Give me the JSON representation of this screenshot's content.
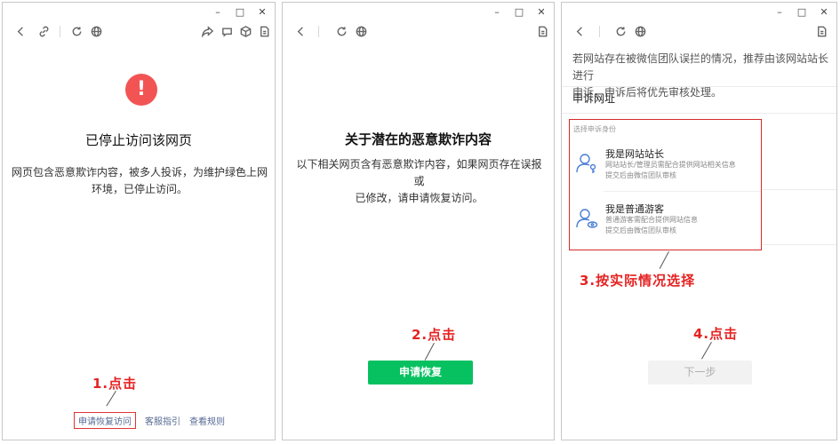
{
  "window_controls": {
    "minimize": "–",
    "maximize": "□",
    "close": "✕"
  },
  "panel1": {
    "title": "已停止访问该网页",
    "desc_line1": "网页包含恶意欺诈内容，被多人投诉，为维护绿色上网",
    "desc_line2": "环境，已停止访问。",
    "links": {
      "appeal": "申请恢复访问",
      "guide": "客服指引",
      "rules": "查看规则"
    },
    "annotation": "1.点击",
    "icons": [
      "back-icon",
      "link-icon",
      "refresh-icon",
      "globe-icon",
      "share-icon",
      "chat-icon",
      "cube-icon",
      "note-icon"
    ]
  },
  "panel2": {
    "title": "关于潜在的恶意欺诈内容",
    "desc_line1": "以下相关网页含有恶意欺诈内容，如果网页存在误报或",
    "desc_line2": "已修改，请申请恢复访问。",
    "button_label": "申请恢复",
    "annotation": "2.点击"
  },
  "panel3": {
    "intro_line1": "若网站存在被微信团队误拦的情况，推荐由该网站站长进行",
    "intro_line2": "申诉，申诉后将优先审核处理。",
    "url_label": "申诉网址",
    "identity_header": "选择申诉身份",
    "options": [
      {
        "title": "我是网站站长",
        "sub_line1": "网站站长/管理员需配合提供网站相关信息",
        "sub_line2": "提交后由微信团队审核"
      },
      {
        "title": "我是普通游客",
        "sub_line1": "普通游客需配合提供网站信息",
        "sub_line2": "提交后由微信团队审核"
      }
    ],
    "annotation_choose": "3.按实际情况选择",
    "annotation_click": "4.点击",
    "next_label": "下一步"
  },
  "colors": {
    "warning_red": "#f25454",
    "wechat_green": "#07c160",
    "annotation_red": "#e62222",
    "link_blue": "#576b95"
  }
}
